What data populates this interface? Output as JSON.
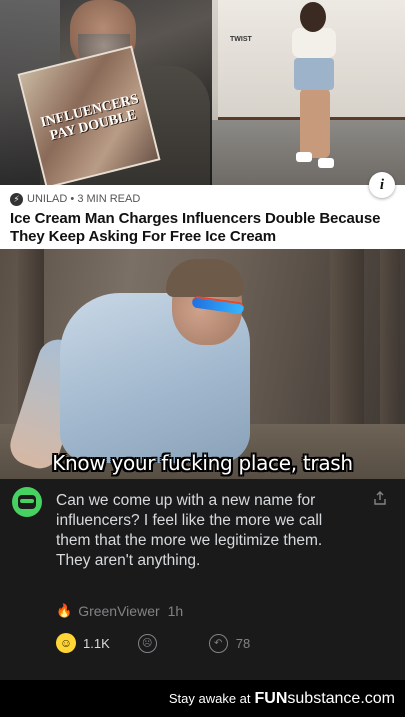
{
  "article": {
    "magazine_text": "INFLUENCERS PAY DOUBLE",
    "truck_text": "TWIST",
    "info_icon": "i",
    "source": "UNILAD",
    "read_time": "3 MIN READ",
    "headline": "Ice Cream Man Charges Influencers Double Because They Keep Asking For Free Ice Cream"
  },
  "meme": {
    "caption": "Know your fucking place, trash"
  },
  "comment": {
    "body": "Can we come up with a new name for influencers? I feel like the more we call them that the more we legitimize them. They aren't anything.",
    "author": "GreenViewer",
    "time": "1h",
    "awards_count": "1.1K",
    "replies_count": "78",
    "colors": {
      "background": "#1a1a1b",
      "avatar": "#46d160",
      "flair": "#ff8717"
    }
  },
  "watermark": {
    "prefix": "Stay awake at",
    "brand": "FUN",
    "brand_tail": "substance.com"
  },
  "icons": [
    "info-icon",
    "bolt-icon",
    "share-icon",
    "flame-icon",
    "smile-icon",
    "frown-icon",
    "reply-icon",
    "avatar-icon"
  ]
}
